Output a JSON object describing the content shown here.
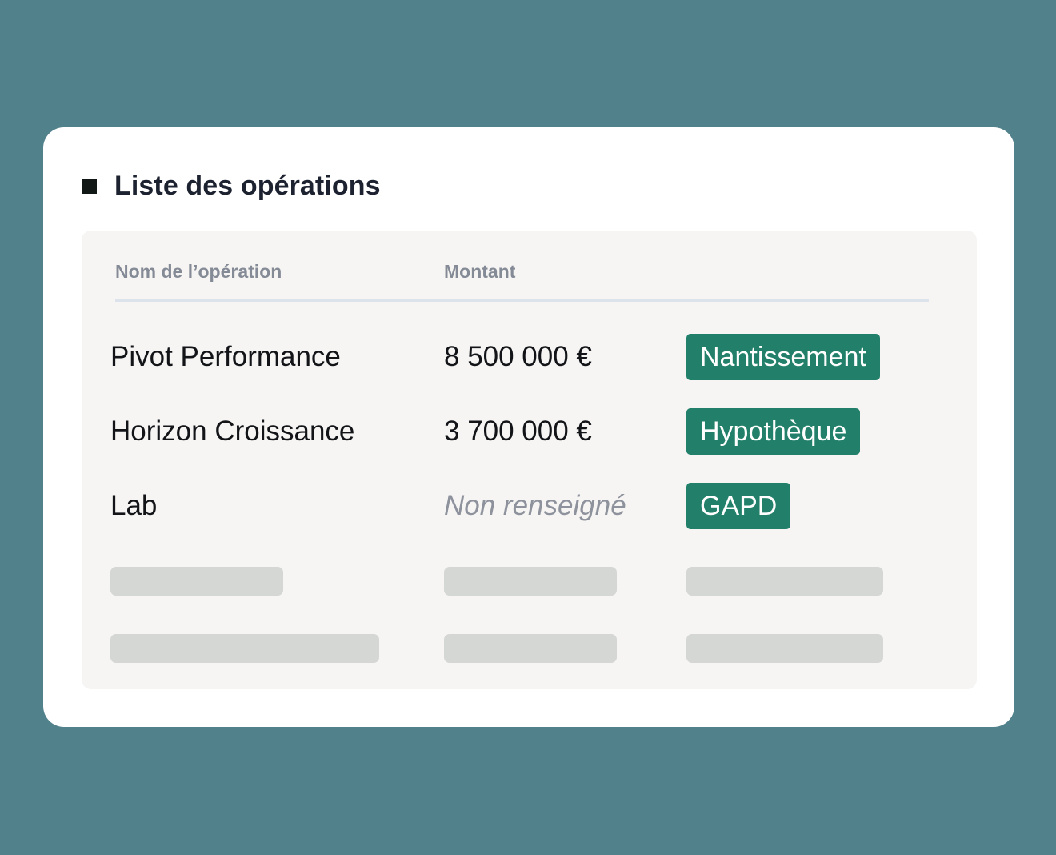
{
  "card": {
    "title": "Liste des opérations"
  },
  "table": {
    "columns": {
      "name": "Nom de l’opération",
      "amount": "Montant"
    },
    "rows": [
      {
        "name": "Pivot Performance",
        "amount": "8 500 000 €",
        "tag": "Nantissement"
      },
      {
        "name": "Horizon Croissance",
        "amount": "3 700 000 €",
        "tag": "Hypothèque"
      },
      {
        "name": "Lab",
        "amount": "Non renseigné",
        "tag": "GAPD"
      }
    ]
  },
  "colors": {
    "background": "#51818b",
    "card": "#ffffff",
    "panel": "#f6f5f3",
    "tag": "#22806a",
    "skeleton": "#d5d7d4",
    "muted_text": "#8d929c"
  }
}
